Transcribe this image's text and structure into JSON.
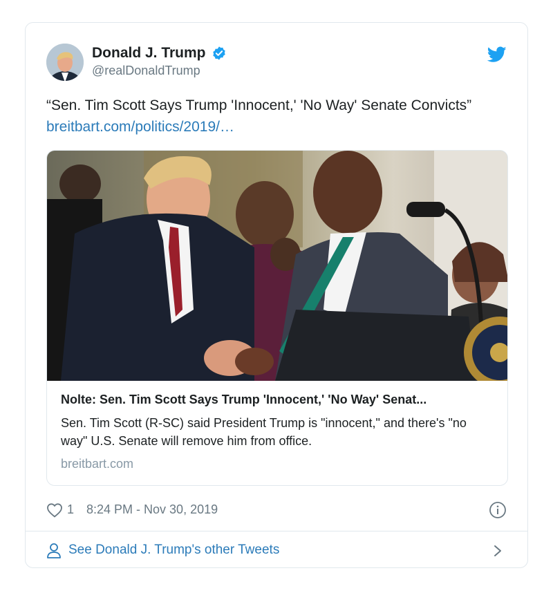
{
  "author": {
    "display_name": "Donald J. Trump",
    "handle": "@realDonaldTrump",
    "avatar": "avatar-photo",
    "verified_icon": "verified-badge-icon"
  },
  "tweet": {
    "text_prefix": "“Sen. Tim Scott Says Trump 'Innocent,' 'No Way' Senate Convicts” ",
    "link_text": "breitbart.com/politics/2019/…"
  },
  "link_card": {
    "image": "handshake-photo",
    "title": "Nolte: Sen. Tim Scott Says Trump 'Innocent,' 'No Way' Senat...",
    "description": "Sen. Tim Scott (R-SC) said President Trump is \"innocent,\" and there's \"no way\" U.S. Senate will remove him from office.",
    "domain": "breitbart.com"
  },
  "meta": {
    "like_count": "1",
    "timestamp": "8:24 PM - Nov 30, 2019"
  },
  "footer": {
    "see_more_label": "See Donald J. Trump's other Tweets"
  },
  "colors": {
    "link": "#2b7bb9",
    "twitter_blue": "#1da1f2",
    "muted": "#697882",
    "border": "#e1e8ed"
  }
}
